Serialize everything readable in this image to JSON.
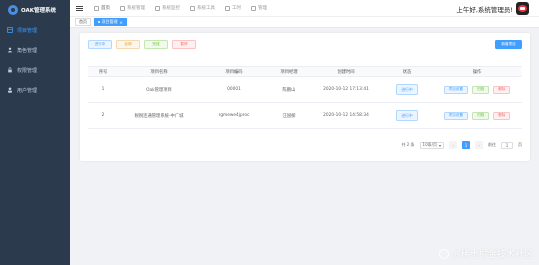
{
  "app": {
    "title": "OAK管理系统"
  },
  "sidebar": {
    "items": [
      {
        "label": "项目管理",
        "icon": "project-icon",
        "active": true
      },
      {
        "label": "角色管理",
        "icon": "role-icon",
        "active": false
      },
      {
        "label": "权限管理",
        "icon": "permission-icon",
        "active": false
      },
      {
        "label": "用户管理",
        "icon": "user-icon",
        "active": false
      }
    ]
  },
  "topnav": {
    "items": [
      {
        "label": "首页"
      },
      {
        "label": "系统管理"
      },
      {
        "label": "系统监控"
      },
      {
        "label": "系统工具"
      },
      {
        "label": "工时"
      },
      {
        "label": "管理"
      }
    ],
    "greeting": "上午好,系统管理员!"
  },
  "tags": [
    {
      "label": "首页",
      "active": false
    },
    {
      "label": "项目管理",
      "active": true
    }
  ],
  "toolbar": {
    "buttons": [
      {
        "label": "进行中"
      },
      {
        "label": "延期"
      },
      {
        "label": "完成"
      },
      {
        "label": "暂停"
      }
    ],
    "add_label": "新增项目"
  },
  "table": {
    "headers": [
      "序号",
      "项目名称",
      "项目编码",
      "项目经理",
      "创建时间",
      "状态",
      "操作"
    ],
    "rows": [
      {
        "index": "1",
        "name": "Oak管理项目",
        "code": "00001",
        "manager": "陈鹏山",
        "created": "2020-10-12 17:13:41",
        "status": "进行中"
      },
      {
        "index": "2",
        "name": "税税连通管理系统-中广城",
        "code": "rgmewe4jproc",
        "manager": "汪国樑",
        "created": "2020-10-12 14:58:34",
        "status": "进行中"
      }
    ],
    "actions": {
      "edit": "项目设置",
      "complete": "归档",
      "delete": "删除"
    }
  },
  "pagination": {
    "total": "共 2 条",
    "page_size": "10条/页",
    "prev": "‹",
    "current": "1",
    "next": "›",
    "goto_label": "前往",
    "goto_value": "1",
    "page_unit": "页"
  },
  "watermark": "@稀土掘金技术社区"
}
